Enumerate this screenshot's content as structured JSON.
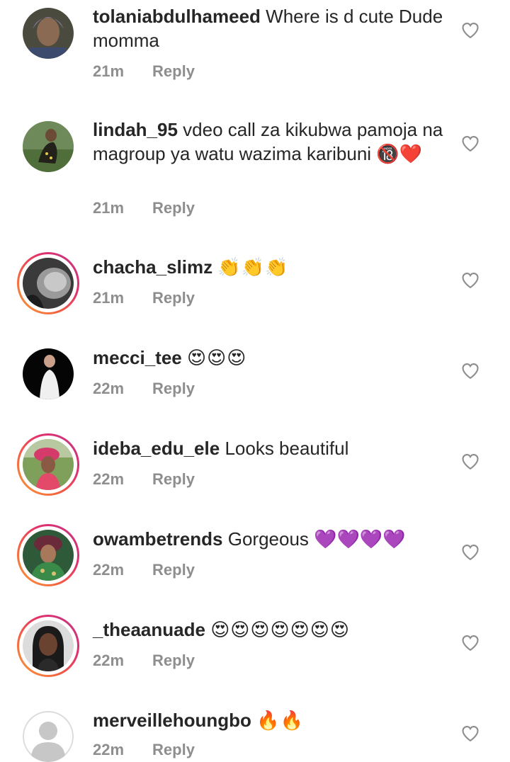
{
  "reply_label": "Reply",
  "comments": [
    {
      "username": "tolaniabdulhameed",
      "text": "Where is d cute Dude momma",
      "time": "21m"
    },
    {
      "username": "lindah_95",
      "text": "vdeo call za kikubwa pamoja na magroup ya watu wazima karibuni 🔞❤️",
      "time": "21m"
    },
    {
      "username": "chacha_slimz",
      "text": "👏👏👏",
      "time": "21m"
    },
    {
      "username": "mecci_tee",
      "text": "😍😍😍",
      "time": "22m"
    },
    {
      "username": "ideba_edu_ele",
      "text": "Looks beautiful",
      "time": "22m"
    },
    {
      "username": "owambetrends",
      "text": "Gorgeous 💜💜💜💜",
      "time": "22m"
    },
    {
      "username": "_theaanuade",
      "text": "😍😍😍😍😍😍😍",
      "time": "22m"
    },
    {
      "username": "merveillehoungbo",
      "text": "🔥🔥",
      "time": "22m"
    }
  ],
  "icons": {
    "like": "heart-outline-icon",
    "avatar_placeholder": "default-avatar-icon"
  },
  "colors": {
    "meta_text": "#8e8e8e",
    "story_ring_start": "#f9a03a",
    "story_ring_end": "#c13584"
  }
}
